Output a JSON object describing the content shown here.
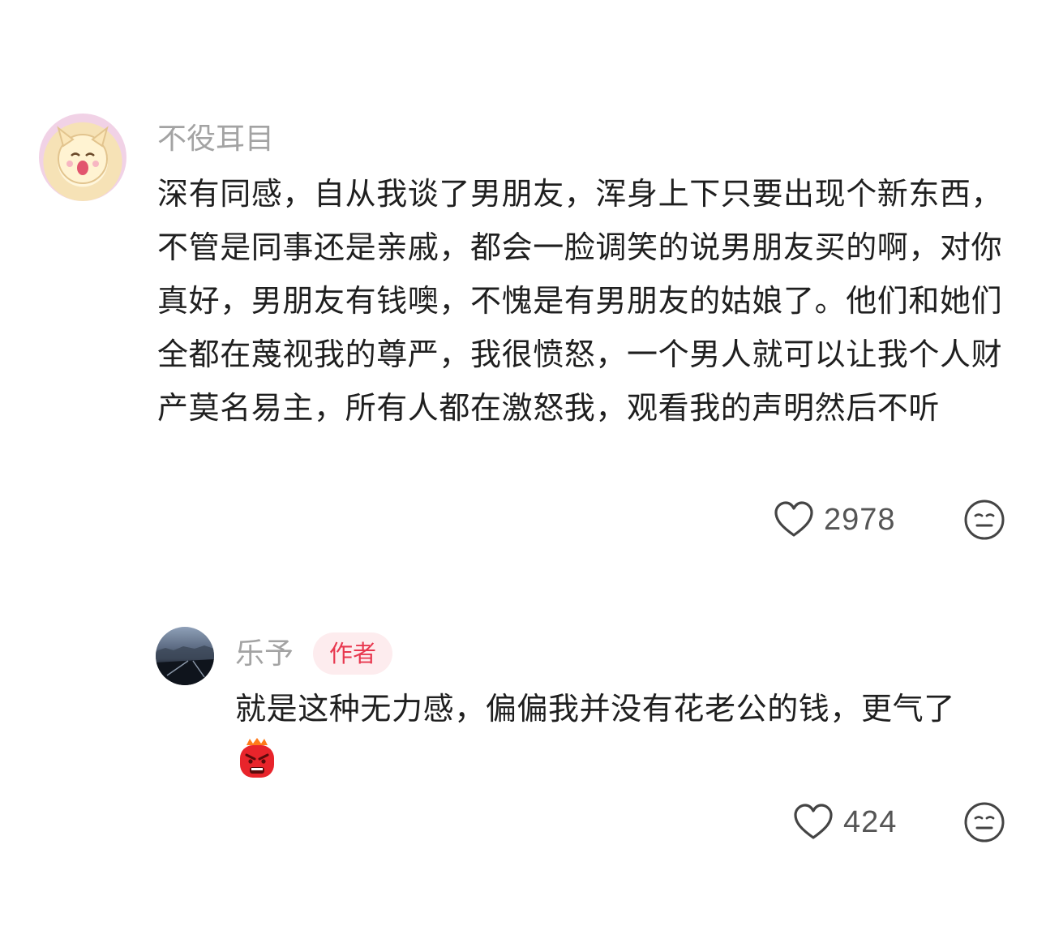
{
  "comments": [
    {
      "username": "不役耳目",
      "avatar_icon": "cartoon-avatar",
      "text": "深有同感，自从我谈了男朋友，浑身上下只要出现个新东西，不管是同事还是亲戚，都会一脸调笑的说男朋友买的啊，对你真好，男朋友有钱噢，不愧是有男朋友的姑娘了。他们和她们全都在蔑视我的尊严，我很愤怒，一个男人就可以让我个人财产莫名易主，所有人都在激怒我，观看我的声明然后不听",
      "likes": "2978",
      "like_icon": "heart-outline-icon",
      "reaction_icon": "neutral-face-icon"
    }
  ],
  "reply": {
    "username": "乐予",
    "badge": "作者",
    "avatar_icon": "photo-avatar",
    "text": "就是这种无力感，偏偏我并没有花老公的钱，更气了",
    "emoji": "angry-face-emoji",
    "likes": "424",
    "like_icon": "heart-outline-icon",
    "reaction_icon": "neutral-face-icon"
  },
  "colors": {
    "username": "#a3a3a3",
    "text": "#1f1f1f",
    "badge_bg": "#fdecee",
    "badge_text": "#e8384f",
    "icon": "#444444"
  }
}
